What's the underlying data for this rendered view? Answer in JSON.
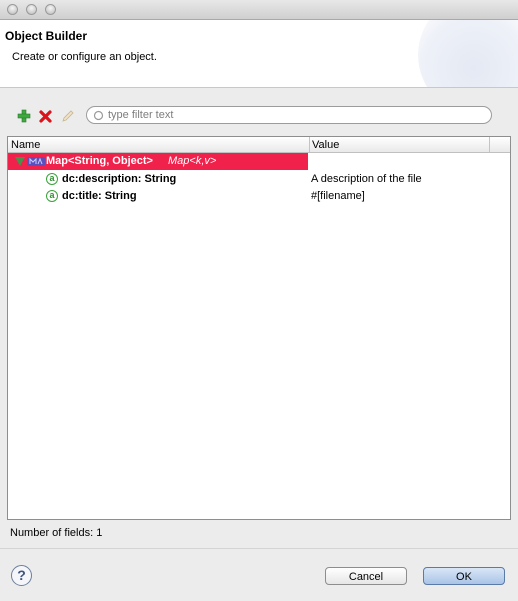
{
  "dialog": {
    "title": "Object Builder",
    "description": "Create or configure an object."
  },
  "toolbar": {
    "add_icon": "plus-icon",
    "remove_icon": "delete-icon",
    "edit_icon": "pencil-icon",
    "filter_placeholder": "type filter text",
    "filter_value": ""
  },
  "tree": {
    "columns": [
      "Name",
      "Value"
    ],
    "root": {
      "label": "Map<String, Object>",
      "type_label": "Map<k,v>",
      "value": "",
      "expanded": true,
      "selected": true,
      "selection_color": "#f0214a"
    },
    "children": [
      {
        "name": "dc:description: String",
        "value": "A description of the file",
        "icon": "attribute-icon"
      },
      {
        "name": "dc:title: String",
        "value": "#[filename]",
        "icon": "attribute-icon"
      }
    ]
  },
  "status": {
    "fields_count_text": "Number of fields: 1"
  },
  "footer": {
    "help_icon": "help-icon",
    "cancel_label": "Cancel",
    "ok_label": "OK"
  }
}
